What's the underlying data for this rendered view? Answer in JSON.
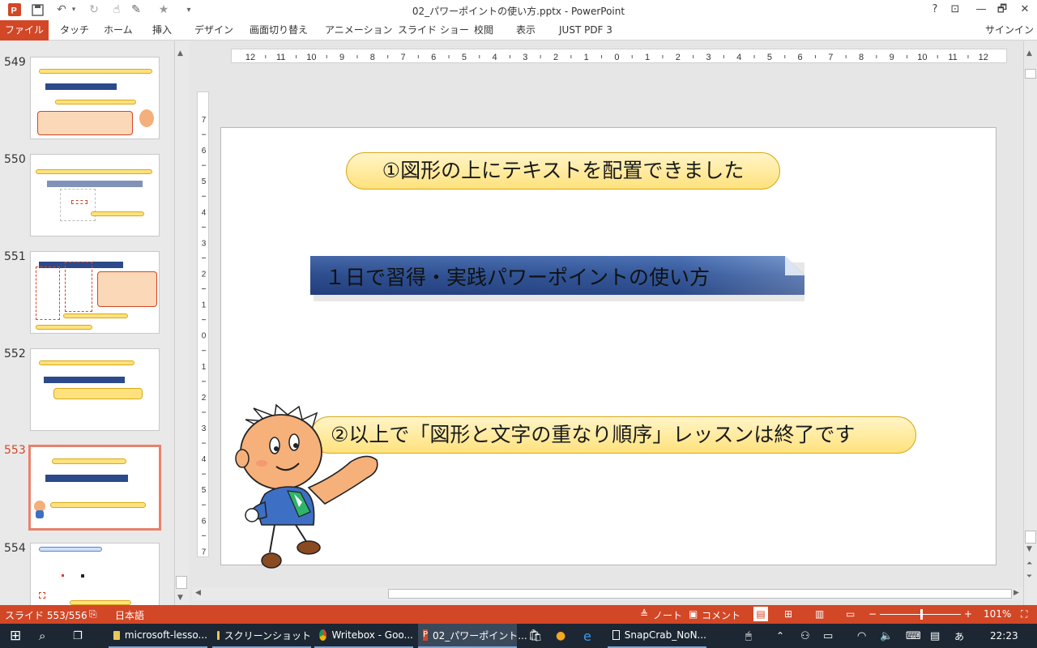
{
  "window": {
    "title": "02_パワーポイントの使い方.pptx - PowerPoint",
    "help": "?",
    "minimize": "—",
    "restore": "🗗",
    "close": "✕"
  },
  "ribbon_tabs": [
    "ファイル",
    "タッチ",
    "ホーム",
    "挿入",
    "デザイン",
    "画面切り替え",
    "アニメーション",
    "スライド ショー",
    "校閲",
    "表示",
    "JUST PDF 3"
  ],
  "signin": "サインイン",
  "thumbnails": [
    {
      "num": "549",
      "selected": false
    },
    {
      "num": "550",
      "selected": false
    },
    {
      "num": "551",
      "selected": false
    },
    {
      "num": "552",
      "selected": false
    },
    {
      "num": "553",
      "selected": true
    },
    {
      "num": "554",
      "selected": false
    }
  ],
  "ruler": {
    "horizontal": [
      "12",
      "11",
      "10",
      "9",
      "8",
      "7",
      "6",
      "5",
      "4",
      "3",
      "2",
      "1",
      "0",
      "1",
      "2",
      "3",
      "4",
      "5",
      "6",
      "7",
      "8",
      "9",
      "10",
      "11",
      "12"
    ],
    "vertical": [
      "7",
      "6",
      "5",
      "4",
      "3",
      "2",
      "1",
      "0",
      "1",
      "2",
      "3",
      "4",
      "5",
      "6",
      "7"
    ]
  },
  "slide": {
    "callout1": "①図形の上にテキストを配置できました",
    "banner": "１日で習得・実践パワーポイントの使い方",
    "callout2": "②以上で「図形と文字の重なり順序」レッスンは終了です"
  },
  "statusbar": {
    "slide_pos": "スライド 553/556",
    "language": "日本語",
    "notes": "ノート",
    "comments": "コメント",
    "zoom": "101%"
  },
  "taskbar": {
    "apps": [
      {
        "label": "microsoft-lesso...",
        "active": false
      },
      {
        "label": "スクリーンショット",
        "active": false
      },
      {
        "label": "Writebox - Goo...",
        "active": false
      },
      {
        "label": "02_パワーポイント...",
        "active": true
      },
      {
        "label": "SnapCrab_NoN...",
        "active": false
      }
    ],
    "ime": "あ",
    "time": "22:23"
  },
  "colors": {
    "accent": "#d24726",
    "callout_fill": "#ffe9a0",
    "callout_border": "#d8a91a",
    "banner_fill": "#2c4a8a"
  }
}
